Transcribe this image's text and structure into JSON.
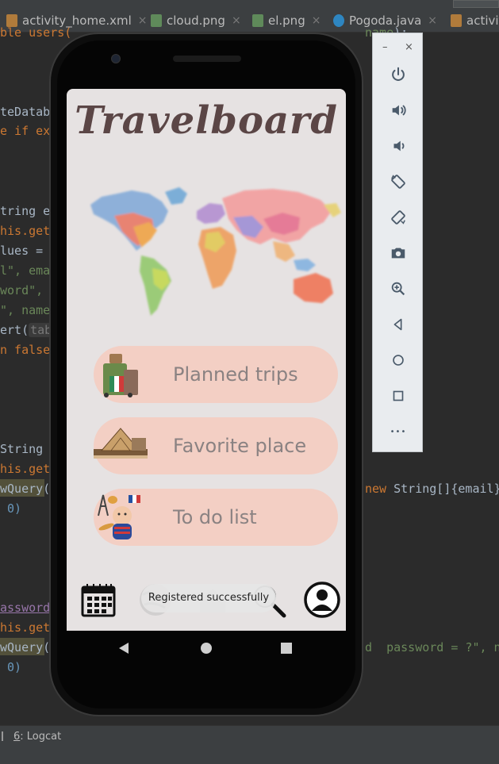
{
  "ide": {
    "tabs": [
      {
        "label": "activity_home.xml",
        "type": "xml"
      },
      {
        "label": "cloud.png",
        "type": "png"
      },
      {
        "label": "el.png",
        "type": "png"
      },
      {
        "label": "Pogoda.java",
        "type": "java"
      },
      {
        "label": "activit",
        "type": "xml"
      }
    ],
    "close_glyph": "×",
    "code": {
      "l1": "ble users(",
      "l1b": "name",
      "l1c": ");",
      "l2": "teDataba",
      "l3": "e if ex",
      "l4": "tring e",
      "l5": "his.get",
      "l6": "lues =",
      "l7a": "l\", ema",
      "l8a": "word\",",
      "l9a": "\", name",
      "l10a": "ert(",
      "l10b": "tabl",
      "l11a": "n false",
      "l12": "String",
      "l13": "his.get",
      "l14": "wQuery(",
      "l14b": "new",
      "l14c": " String[]{email}",
      "l15": " 0)",
      "l16": "assword",
      "l17": "his.get",
      "l18": "wQuery(",
      "l18b": "d  password = ?\", ne",
      "l19": " 0)"
    },
    "status": {
      "index": "6",
      "label": "Logcat"
    }
  },
  "emulator_panel": {
    "minimize": "–",
    "close": "×",
    "buttons": [
      "power-icon",
      "volume-up-icon",
      "volume-down-icon",
      "rotate-left-icon",
      "rotate-right-icon",
      "camera-icon",
      "zoom-icon",
      "back-icon",
      "home-icon",
      "overview-icon",
      "more-icon"
    ],
    "more_glyph": "•••"
  },
  "app": {
    "title": "Travelboard",
    "menu": [
      {
        "label": "Planned trips"
      },
      {
        "label": "Favorite place"
      },
      {
        "label": "To do list"
      }
    ],
    "toast": "Registered successfully",
    "bottom_nav": [
      "calendar-icon",
      "globe-icon",
      "home-icon",
      "search-icon",
      "profile-icon"
    ]
  },
  "colors": {
    "button_bg": "#f3cfc4",
    "screen_bg": "#e6e2e2",
    "title": "#5b4646"
  }
}
